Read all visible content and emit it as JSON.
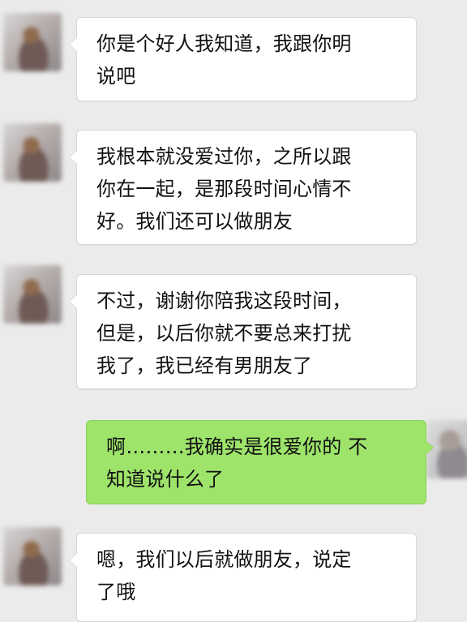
{
  "chat": {
    "messages": [
      {
        "sender": "other",
        "text": "你是个好人我知道，我跟你明\n说吧"
      },
      {
        "sender": "other",
        "text": "我根本就没爱过你，之所以跟\n你在一起，是那段时间心情不\n好。我们还可以做朋友"
      },
      {
        "sender": "other",
        "text": "不过，谢谢你陪我这段时间，\n但是，以后你就不要总来打扰\n我了，我已经有男朋友了"
      },
      {
        "sender": "self",
        "text": "啊………我确实是很爱你的 不\n知道说什么了"
      },
      {
        "sender": "other",
        "text": "嗯，我们以后就做朋友，说定\n了哦"
      }
    ]
  }
}
